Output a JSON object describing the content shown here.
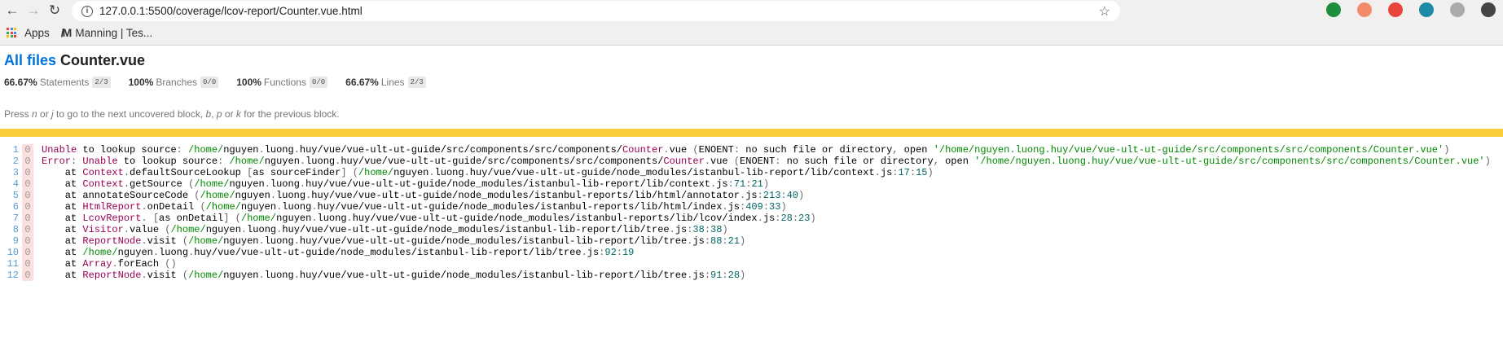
{
  "browser": {
    "url": "127.0.0.1:5500/coverage/lcov-report/Counter.vue.html",
    "bookmarks": [
      {
        "label": "Apps",
        "icon": "apps-grid-icon"
      },
      {
        "label": "Manning | Tes...",
        "icon": "manning-logo-icon"
      }
    ],
    "extensions": [
      {
        "name": "green-extension-icon",
        "color": "#1e8e3e"
      },
      {
        "name": "orange-extension-icon",
        "color": "#f28b6b"
      },
      {
        "name": "red-extension-icon",
        "color": "#e8453c"
      },
      {
        "name": "n-extension-icon",
        "color": "#1b8ca3"
      },
      {
        "name": "vue-devtools-icon",
        "color": "#aaaaaa"
      },
      {
        "name": "puzzle-icon",
        "color": "#444444"
      },
      {
        "name": "playlist-icon",
        "color": "#444444"
      }
    ]
  },
  "report": {
    "breadcrumb_link": "All files",
    "file": "Counter.vue",
    "stats": [
      {
        "pct": "66.67%",
        "label": "Statements",
        "frac": "2/3"
      },
      {
        "pct": "100%",
        "label": "Branches",
        "frac": "0/0"
      },
      {
        "pct": "100%",
        "label": "Functions",
        "frac": "0/0"
      },
      {
        "pct": "66.67%",
        "label": "Lines",
        "frac": "2/3"
      }
    ],
    "help": [
      "Press ",
      "n",
      " or ",
      "j",
      " to go to the next uncovered block, ",
      "b",
      ", ",
      "p",
      " or ",
      "k",
      " for the previous block."
    ],
    "status_color": "#f9cd3c"
  },
  "code": [
    {
      "n": "1",
      "c": "0",
      "s": "Unable to lookup source: /home/nguyen.luong.huy/vue/vue-ult-ut-guide/src/components/src/components/Counter.vue (ENOENT: no such file or directory, open '/home/nguyen.luong.huy/vue/vue-ult-ut-guide/src/components/src/components/Counter.vue')"
    },
    {
      "n": "2",
      "c": "0",
      "s": "Error: Unable to lookup source: /home/nguyen.luong.huy/vue/vue-ult-ut-guide/src/components/src/components/Counter.vue (ENOENT: no such file or directory, open '/home/nguyen.luong.huy/vue/vue-ult-ut-guide/src/components/src/components/Counter.vue')"
    },
    {
      "n": "3",
      "c": "0",
      "s": "    at Context.defaultSourceLookup [as sourceFinder] (/home/nguyen.luong.huy/vue/vue-ult-ut-guide/node_modules/istanbul-lib-report/lib/context.js:17:15)"
    },
    {
      "n": "4",
      "c": "0",
      "s": "    at Context.getSource (/home/nguyen.luong.huy/vue/vue-ult-ut-guide/node_modules/istanbul-lib-report/lib/context.js:71:21)"
    },
    {
      "n": "5",
      "c": "0",
      "s": "    at annotateSourceCode (/home/nguyen.luong.huy/vue/vue-ult-ut-guide/node_modules/istanbul-reports/lib/html/annotator.js:213:40)"
    },
    {
      "n": "6",
      "c": "0",
      "s": "    at HtmlReport.onDetail (/home/nguyen.luong.huy/vue/vue-ult-ut-guide/node_modules/istanbul-reports/lib/html/index.js:409:33)"
    },
    {
      "n": "7",
      "c": "0",
      "s": "    at LcovReport. [as onDetail] (/home/nguyen.luong.huy/vue/vue-ult-ut-guide/node_modules/istanbul-reports/lib/lcov/index.js:28:23)"
    },
    {
      "n": "8",
      "c": "0",
      "s": "    at Visitor.value (/home/nguyen.luong.huy/vue/vue-ult-ut-guide/node_modules/istanbul-lib-report/lib/tree.js:38:38)"
    },
    {
      "n": "9",
      "c": "0",
      "s": "    at ReportNode.visit (/home/nguyen.luong.huy/vue/vue-ult-ut-guide/node_modules/istanbul-lib-report/lib/tree.js:88:21)"
    },
    {
      "n": "10",
      "c": "0",
      "s": "    at /home/nguyen.luong.huy/vue/vue-ult-ut-guide/node_modules/istanbul-lib-report/lib/tree.js:92:19"
    },
    {
      "n": "11",
      "c": "0",
      "s": "    at Array.forEach ()"
    },
    {
      "n": "12",
      "c": "0",
      "s": "    at ReportNode.visit (/home/nguyen.luong.huy/vue/vue-ult-ut-guide/node_modules/istanbul-lib-report/lib/tree.js:91:28)"
    }
  ]
}
